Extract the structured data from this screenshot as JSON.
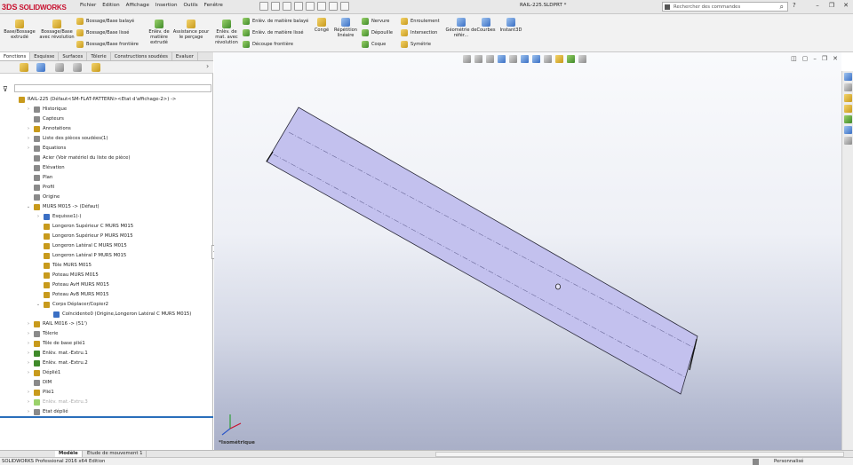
{
  "app": {
    "brand_prefix": "3DS",
    "brand_name": "SOLIDWORKS",
    "document_title": "RAIL-225.SLDPRT *",
    "search_placeholder": "Rechercher des commandes",
    "help_label": "?"
  },
  "menu": [
    "Fichier",
    "Edition",
    "Affichage",
    "Insertion",
    "Outils",
    "Fenêtre"
  ],
  "ribbon": {
    "big": [
      {
        "label": "Base/Bossage extrudé",
        "icon": "extruded-boss-icon"
      },
      {
        "label": "Bossage/Base avec révolution",
        "icon": "revolved-boss-icon"
      },
      {
        "label": "Enlèv. de matière extrudé",
        "icon": "extruded-cut-icon"
      },
      {
        "label": "Assistance pour le perçage",
        "icon": "hole-wizard-icon"
      },
      {
        "label": "Enlèv. de mat. avec révolution",
        "icon": "revolved-cut-icon"
      },
      {
        "label": "Congé",
        "icon": "fillet-icon"
      },
      {
        "label": "Répétition linéaire",
        "icon": "linear-pattern-icon"
      },
      {
        "label": "Géométrie de référ...",
        "icon": "reference-geometry-icon"
      },
      {
        "label": "Courbes",
        "icon": "curves-icon"
      },
      {
        "label": "Instant3D",
        "icon": "instant3d-icon"
      }
    ],
    "small_col1": [
      "Bossage/Base balayé",
      "Bossage/Base lissé",
      "Bossage/Base frontière"
    ],
    "small_col2": [
      "Enlèv. de matière balayé",
      "Enlèv. de matière lissé",
      "Découpe frontière"
    ],
    "small_col3": [
      "Nervure",
      "Dépouille",
      "Coque"
    ],
    "small_col4": [
      "Enroulement",
      "Intersection",
      "Symétrie"
    ]
  },
  "tabs": [
    "Fonctions",
    "Esquisse",
    "Surfaces",
    "Tôlerie",
    "Constructions soudées",
    "Evaluer"
  ],
  "tree": [
    {
      "level": 0,
      "label": "RAIL-225 (Défaut<SM-FLAT-PATTERN><Etat d'affichage-2>) ->",
      "exp": "",
      "icon": "part-icon",
      "color": "#c89a1c"
    },
    {
      "level": 1,
      "label": "Historique",
      "exp": "›",
      "icon": "history-icon",
      "color": "#8a8a8a"
    },
    {
      "level": 1,
      "label": "Capteurs",
      "exp": "",
      "icon": "sensors-icon",
      "color": "#8a8a8a"
    },
    {
      "level": 1,
      "label": "Annotations",
      "exp": "›",
      "icon": "annotations-icon",
      "color": "#c89a1c"
    },
    {
      "level": 1,
      "label": "Liste des pièces soudées(1)",
      "exp": "›",
      "icon": "cut-list-icon",
      "color": "#8a8a8a"
    },
    {
      "level": 1,
      "label": "Equations",
      "exp": "›",
      "icon": "equations-icon",
      "color": "#8a8a8a"
    },
    {
      "level": 1,
      "label": "Acier (Voir matériel du liste de pièce)",
      "exp": "",
      "icon": "material-icon",
      "color": "#8a8a8a"
    },
    {
      "level": 1,
      "label": "Elévation",
      "exp": "",
      "icon": "plane-icon",
      "color": "#8a8a8a"
    },
    {
      "level": 1,
      "label": "Plan",
      "exp": "",
      "icon": "plane-icon",
      "color": "#8a8a8a"
    },
    {
      "level": 1,
      "label": "Profil",
      "exp": "",
      "icon": "plane-icon",
      "color": "#8a8a8a"
    },
    {
      "level": 1,
      "label": "Origine",
      "exp": "",
      "icon": "origin-icon",
      "color": "#8a8a8a"
    },
    {
      "level": 1,
      "label": "MURS M015 -> (Défaut)",
      "exp": "⌄",
      "icon": "assembly-icon",
      "color": "#c89a1c"
    },
    {
      "level": 2,
      "label": "Esquisse1(-)",
      "exp": "›",
      "icon": "sketch-icon",
      "color": "#3a6fc4"
    },
    {
      "level": 2,
      "label": "Longeron Supérieur C MURS M015",
      "exp": "",
      "icon": "body-icon",
      "color": "#c89a1c"
    },
    {
      "level": 2,
      "label": "Longeron Supérieur P MURS M015",
      "exp": "",
      "icon": "body-icon",
      "color": "#c89a1c"
    },
    {
      "level": 2,
      "label": "Longeron Latéral C MURS M015",
      "exp": "",
      "icon": "body-icon",
      "color": "#c89a1c"
    },
    {
      "level": 2,
      "label": "Longeron Latéral P MURS M015",
      "exp": "",
      "icon": "body-icon",
      "color": "#c89a1c"
    },
    {
      "level": 2,
      "label": "Tôle MURS M015",
      "exp": "",
      "icon": "body-icon",
      "color": "#c89a1c"
    },
    {
      "level": 2,
      "label": "Poteau MURS M015",
      "exp": "",
      "icon": "body-icon",
      "color": "#c89a1c"
    },
    {
      "level": 2,
      "label": "Poteau AvH MURS M015",
      "exp": "",
      "icon": "body-icon",
      "color": "#c89a1c"
    },
    {
      "level": 2,
      "label": "Poteau AvB MURS M015",
      "exp": "",
      "icon": "body-icon",
      "color": "#c89a1c"
    },
    {
      "level": 2,
      "label": "Corps Déplacer/Copier2",
      "exp": "⌄",
      "icon": "move-copy-icon",
      "color": "#c89a1c"
    },
    {
      "level": 3,
      "label": "Coïncidente0 (Origine,Longeron Latéral C MURS M015)",
      "exp": "",
      "icon": "mate-icon",
      "color": "#3a6fc4"
    },
    {
      "level": 1,
      "label": "RAIL M016 -> (51')",
      "exp": "›",
      "icon": "assembly-icon",
      "color": "#c89a1c"
    },
    {
      "level": 1,
      "label": "Tôlerie",
      "exp": "›",
      "icon": "sheet-metal-icon",
      "color": "#8a8a8a"
    },
    {
      "level": 1,
      "label": "Tôle de base plié1",
      "exp": "›",
      "icon": "base-flange-icon",
      "color": "#c89a1c"
    },
    {
      "level": 1,
      "label": "Enlèv. mat.-Extru.1",
      "exp": "›",
      "icon": "cut-extrude-icon",
      "color": "#3f8a2a"
    },
    {
      "level": 1,
      "label": "Enlèv. mat.-Extru.2",
      "exp": "›",
      "icon": "cut-extrude-icon",
      "color": "#3f8a2a"
    },
    {
      "level": 1,
      "label": "Déplié1",
      "exp": "›",
      "icon": "unfold-icon",
      "color": "#c89a1c"
    },
    {
      "level": 1,
      "label": "DIM",
      "exp": "",
      "icon": "sketch-icon",
      "color": "#8a8a8a"
    },
    {
      "level": 1,
      "label": "Plié1",
      "exp": "›",
      "icon": "fold-icon",
      "color": "#c89a1c"
    },
    {
      "level": 1,
      "label": "Enlèv. mat.-Extru.3",
      "exp": "›",
      "icon": "cut-extrude-icon",
      "color": "#9bd26b",
      "dim": true
    },
    {
      "level": 1,
      "label": "Etat déplié",
      "exp": "›",
      "icon": "flat-pattern-icon",
      "color": "#8a8a8a"
    }
  ],
  "viewport": {
    "view_label": "*Isométrique",
    "part_color": "#c3c1ee"
  },
  "bottom_tabs": [
    "Modèle",
    "Etude de mouvement 1"
  ],
  "status": {
    "left": "SOLIDWORKS Professional 2016 x64 Edition",
    "right": "Personnalisé"
  }
}
